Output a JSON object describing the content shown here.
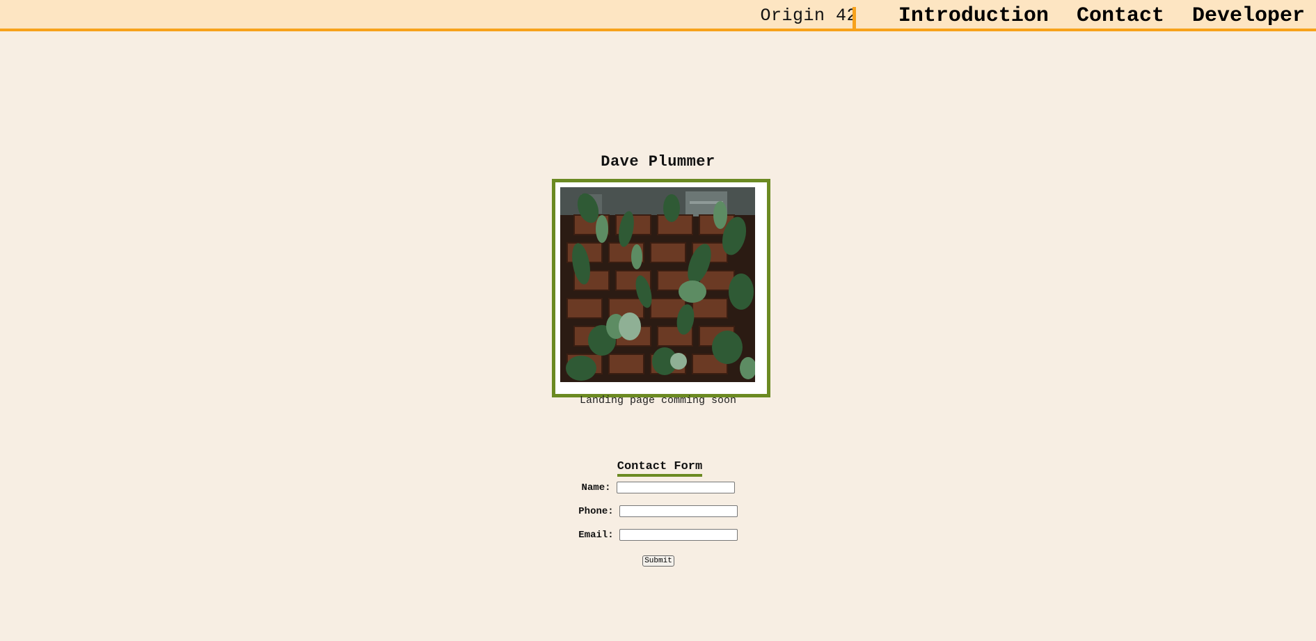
{
  "header": {
    "brand": "Origin 42",
    "nav": [
      {
        "label": "Introduction"
      },
      {
        "label": "Contact"
      },
      {
        "label": "Developer"
      }
    ]
  },
  "profile": {
    "name": "Dave Plummer",
    "caption": "Landing page comming soon"
  },
  "contact_form": {
    "title": "Contact Form",
    "fields": [
      {
        "label": "Name:",
        "value": ""
      },
      {
        "label": "Phone:",
        "value": ""
      },
      {
        "label": "Email:",
        "value": ""
      }
    ],
    "submit_label": "Submit"
  },
  "colors": {
    "background": "#f7eee3",
    "header_bg": "#fde5c2",
    "accent_orange": "#f7a21b",
    "accent_green": "#6b8a22"
  }
}
